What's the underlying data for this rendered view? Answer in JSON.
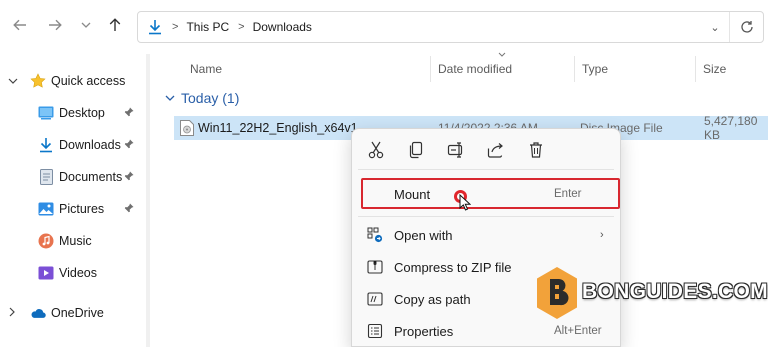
{
  "navigation": {
    "back_icon": "arrow-left-icon",
    "forward_icon": "arrow-right-icon",
    "recent_icon": "chevron-down-icon",
    "up_icon": "arrow-up-icon"
  },
  "address_bar": {
    "crumbs": [
      "This PC",
      "Downloads"
    ],
    "separator": ">",
    "dropdown_glyph": "⌄",
    "refresh_glyph": "↻"
  },
  "sidebar": {
    "items": [
      {
        "label": "Quick access",
        "icon": "star-icon",
        "expandable": true,
        "pinned": false
      },
      {
        "label": "Desktop",
        "icon": "desktop-folder-icon",
        "pinned": true
      },
      {
        "label": "Downloads",
        "icon": "download-icon",
        "pinned": true
      },
      {
        "label": "Documents",
        "icon": "documents-icon",
        "pinned": true
      },
      {
        "label": "Pictures",
        "icon": "pictures-icon",
        "pinned": true
      },
      {
        "label": "Music",
        "icon": "music-icon",
        "pinned": false
      },
      {
        "label": "Videos",
        "icon": "videos-icon",
        "pinned": false
      },
      {
        "label": "OneDrive",
        "icon": "onedrive-icon",
        "expandable": true,
        "pinned": false
      }
    ]
  },
  "columns": {
    "name": "Name",
    "date_modified": "Date modified",
    "type": "Type",
    "size": "Size"
  },
  "group": {
    "label": "Today (1)"
  },
  "file": {
    "name": "Win11_22H2_English_x64v1",
    "date_modified": "11/4/2022 2:36 AM",
    "type": "Disc Image File",
    "size": "5,427,180 KB"
  },
  "context_menu": {
    "toolbar": [
      {
        "name": "cut-icon"
      },
      {
        "name": "copy-icon"
      },
      {
        "name": "rename-icon"
      },
      {
        "name": "share-icon"
      },
      {
        "name": "delete-icon"
      }
    ],
    "items": [
      {
        "label": "Mount",
        "shortcut": "Enter",
        "icon": "",
        "highlighted": true
      },
      {
        "label": "Open with",
        "shortcut": "",
        "icon": "open-with-icon",
        "submenu": true
      },
      {
        "label": "Compress to ZIP file",
        "shortcut": "",
        "icon": "zip-icon"
      },
      {
        "label": "Copy as path",
        "shortcut": "",
        "icon": "copy-path-icon"
      },
      {
        "label": "Properties",
        "shortcut": "Alt+Enter",
        "icon": "properties-icon"
      }
    ],
    "submenu_arrow": "›"
  },
  "watermark": {
    "text": "BONGUIDES.COM"
  },
  "colors": {
    "accent": "#0067c0",
    "selection": "#cce4f7",
    "highlight_border": "#d8272f",
    "group_header": "#2a5fa8",
    "watermark_orange": "#f2a23a"
  }
}
